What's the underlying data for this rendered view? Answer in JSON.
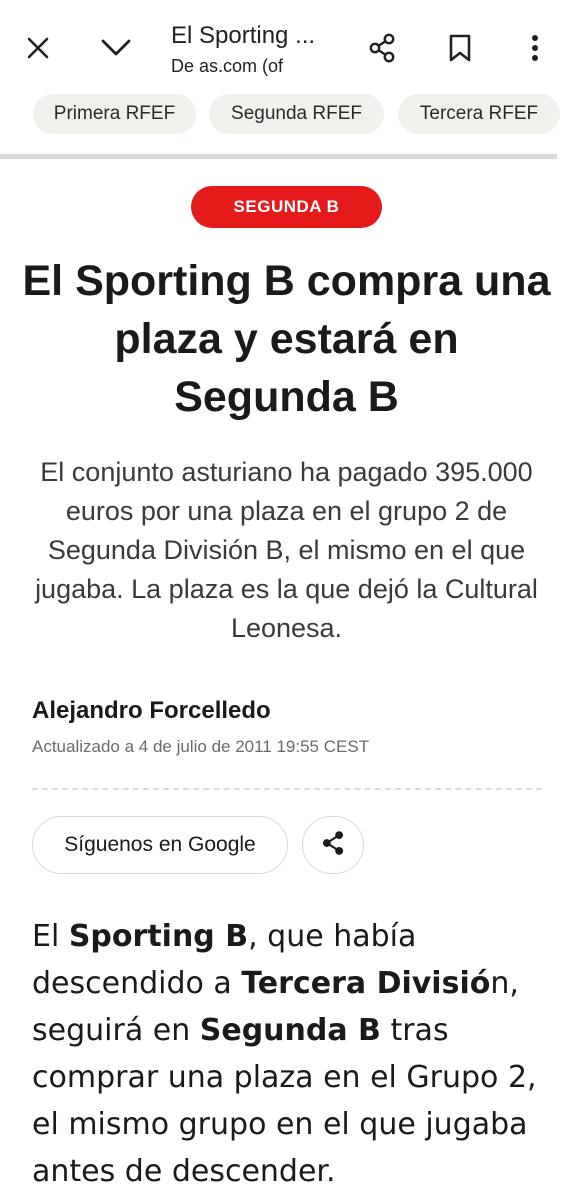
{
  "browser": {
    "title": "El Sporting ...",
    "subtitle": "De as.com (of",
    "icons": {
      "close": "close-icon",
      "collapse": "chevron-down-icon",
      "share": "share-icon",
      "bookmark": "bookmark-icon",
      "menu": "more-vert-icon"
    }
  },
  "tabs": [
    "Primera RFEF",
    "Segunda RFEF",
    "Tercera RFEF"
  ],
  "article": {
    "category": "SEGUNDA B",
    "headline": "El Sporting B compra una plaza y estará en Segunda B",
    "subheadline": "El conjunto asturiano ha pagado 395.000 euros por una plaza en el grupo 2 de Segunda División B, el mismo en el que jugaba. La plaza es la que dejó la Cultural Leonesa.",
    "author": "Alejandro Forcelledo",
    "updated": "Actualizado a 4 de julio de 2011 19:55 CEST",
    "follow_label": "Síguenos en Google",
    "body": {
      "t1": "El ",
      "b1": "Sporting B",
      "t2": ", que había descendido a ",
      "b2": "Tercera Divisió",
      "t3": "n, seguirá en ",
      "b3": "Segunda B",
      "t4": " tras comprar una plaza en el Grupo 2, el mismo grupo en el que jugaba antes de descender."
    }
  },
  "colors": {
    "accent": "#e51b1b",
    "chip_bg": "#f2f0ec",
    "text": "#1a1a1a",
    "muted": "#6b6b6b"
  }
}
